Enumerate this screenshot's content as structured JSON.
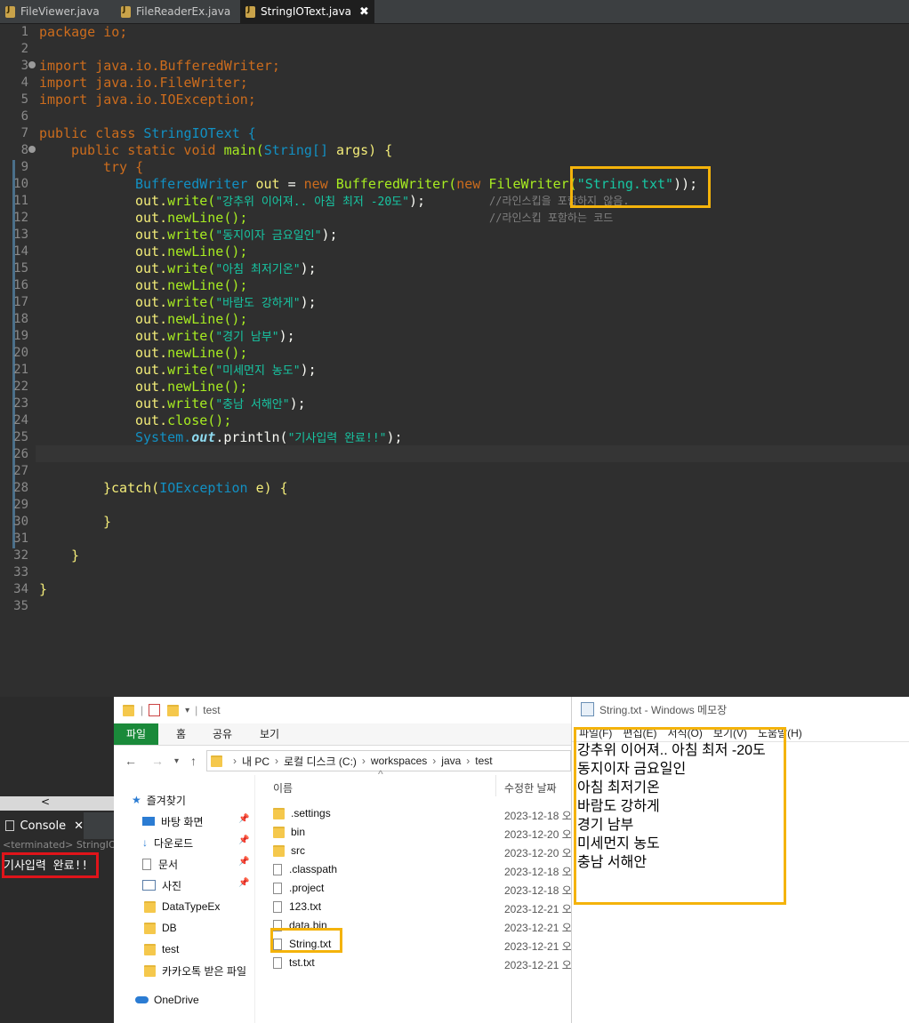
{
  "editor": {
    "tabs": [
      {
        "label": "FileViewer.java"
      },
      {
        "label": "FileReaderEx.java"
      },
      {
        "label": "StringIOText.java",
        "close": "✖"
      }
    ],
    "line_numbers": [
      "1",
      "2",
      "3",
      "4",
      "5",
      "6",
      "7",
      "8",
      "9",
      "10",
      "11",
      "12",
      "13",
      "14",
      "15",
      "16",
      "17",
      "18",
      "19",
      "20",
      "21",
      "22",
      "23",
      "24",
      "25",
      "26",
      "27",
      "28",
      "29",
      "30",
      "31",
      "32",
      "33",
      "34",
      "35"
    ],
    "code": {
      "l1": "package io;",
      "l3": "import java.io.BufferedWriter;",
      "l4": "import java.io.FileWriter;",
      "l5": "import java.io.IOException;",
      "l7a": "public class",
      "l7b": "StringIOText {",
      "l8a": "public static void",
      "l8b": "main(",
      "l8c": "String[]",
      "l8d": "args) {",
      "l9": "try {",
      "l10a": "BufferedWriter",
      "l10b": "out",
      "l10c": "=",
      "l10d": "new",
      "l10e": "BufferedWriter(",
      "l10f": "new",
      "l10g": "FileWriter(",
      "l10h": "\"String.txt\"",
      "l10i": "));",
      "l11a": "out.",
      "l11b": "write(",
      "l11c": "\"강추위 이어져.. 아침 최저 -20도\"",
      "l11d": ");",
      "l11e": "//라인스킵을 포함하지 않음.",
      "l12a": "out.",
      "l12b": "newLine();",
      "l12e": "//라인스킵 포함하는 코드",
      "writes": [
        "\"동지이자 금요일인\"",
        "\"아침 최저기온\"",
        "\"바람도 강하게\"",
        "\"경기 남부\"",
        "\"미세먼지 농도\"",
        "\"충남 서해안\""
      ],
      "out": "out.",
      "write": "write(",
      "close_paren": ");",
      "newline": "newLine();",
      "close": "close();",
      "l25a": "System.",
      "l25b": "out",
      "l25c": ".println(",
      "l25d": "\"기사입력 완료!!\"",
      "l25e": ");",
      "l28a": "}catch(",
      "l28b": "IOException",
      "l28c": "e) {",
      "l30": "}",
      "l32": "}",
      "l34": "}"
    }
  },
  "console": {
    "tab_label": "Console",
    "status": "<terminated> StringIOT",
    "output": "기사입력 완료!!"
  },
  "explorer": {
    "title": "test",
    "ribbon_tabs": [
      "파일",
      "홈",
      "공유",
      "보기"
    ],
    "address": [
      "내 PC",
      "로컬 디스크 (C:)",
      "workspaces",
      "java",
      "test"
    ],
    "nav": [
      {
        "label": "즐겨찾기",
        "icon": "star-icon"
      },
      {
        "label": "바탕 화면",
        "icon": "desktop-icon",
        "pinned": true
      },
      {
        "label": "다운로드",
        "icon": "download-icon",
        "pinned": true
      },
      {
        "label": "문서",
        "icon": "document-icon",
        "pinned": true
      },
      {
        "label": "사진",
        "icon": "picture-icon",
        "pinned": true
      },
      {
        "label": "DataTypeEx",
        "icon": "folder-icon"
      },
      {
        "label": "DB",
        "icon": "folder-icon"
      },
      {
        "label": "test",
        "icon": "folder-icon"
      },
      {
        "label": "카카오톡 받은 파일",
        "icon": "folder-icon"
      },
      {
        "label": "OneDrive",
        "icon": "cloud-icon"
      }
    ],
    "columns": [
      "이름",
      "수정한 날짜"
    ],
    "files": [
      {
        "name": ".settings",
        "date": "2023-12-18 오",
        "type": "folder"
      },
      {
        "name": "bin",
        "date": "2023-12-20 오",
        "type": "folder"
      },
      {
        "name": "src",
        "date": "2023-12-20 오",
        "type": "folder"
      },
      {
        "name": ".classpath",
        "date": "2023-12-18 오",
        "type": "file"
      },
      {
        "name": ".project",
        "date": "2023-12-18 오",
        "type": "file"
      },
      {
        "name": "123.txt",
        "date": "2023-12-21 오",
        "type": "file"
      },
      {
        "name": "data.bin",
        "date": "2023-12-21 오",
        "type": "file"
      },
      {
        "name": "String.txt",
        "date": "2023-12-21 오",
        "type": "file"
      },
      {
        "name": "tst.txt",
        "date": "2023-12-21 오",
        "type": "file"
      }
    ]
  },
  "notepad": {
    "title": "String.txt - Windows 메모장",
    "menu": [
      "파일(F)",
      "편집(E)",
      "서식(O)",
      "보기(V)",
      "도움말(H)"
    ],
    "lines": [
      "강추위 이어져.. 아침 최저 -20도",
      "동지이자 금요일인",
      "아침 최저기온",
      "바람도 강하게",
      "경기 남부",
      "미세먼지 농도",
      "충남 서해안"
    ]
  },
  "colors": {
    "highlight": "#f4b30b",
    "console_highlight": "#e0141a",
    "keyword": "#cc6c1d",
    "type": "#1290c3",
    "string": "#17c6a3"
  }
}
